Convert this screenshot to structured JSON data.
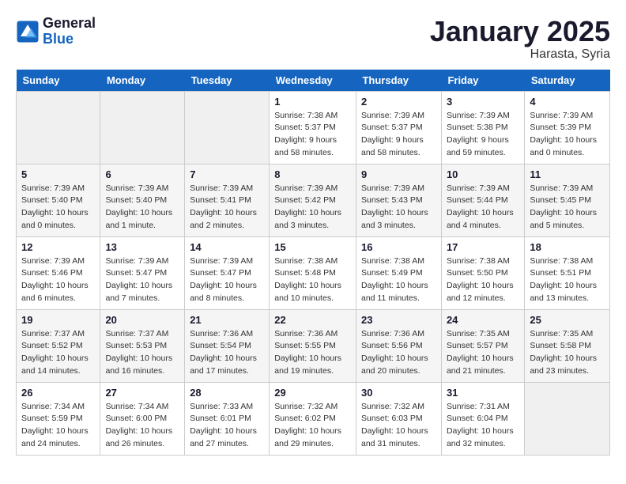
{
  "logo": {
    "text_general": "General",
    "text_blue": "Blue"
  },
  "title": "January 2025",
  "subtitle": "Harasta, Syria",
  "days_of_week": [
    "Sunday",
    "Monday",
    "Tuesday",
    "Wednesday",
    "Thursday",
    "Friday",
    "Saturday"
  ],
  "weeks": [
    [
      {
        "day": "",
        "info": ""
      },
      {
        "day": "",
        "info": ""
      },
      {
        "day": "",
        "info": ""
      },
      {
        "day": "1",
        "info": "Sunrise: 7:38 AM\nSunset: 5:37 PM\nDaylight: 9 hours and 58 minutes."
      },
      {
        "day": "2",
        "info": "Sunrise: 7:39 AM\nSunset: 5:37 PM\nDaylight: 9 hours and 58 minutes."
      },
      {
        "day": "3",
        "info": "Sunrise: 7:39 AM\nSunset: 5:38 PM\nDaylight: 9 hours and 59 minutes."
      },
      {
        "day": "4",
        "info": "Sunrise: 7:39 AM\nSunset: 5:39 PM\nDaylight: 10 hours and 0 minutes."
      }
    ],
    [
      {
        "day": "5",
        "info": "Sunrise: 7:39 AM\nSunset: 5:40 PM\nDaylight: 10 hours and 0 minutes."
      },
      {
        "day": "6",
        "info": "Sunrise: 7:39 AM\nSunset: 5:40 PM\nDaylight: 10 hours and 1 minute."
      },
      {
        "day": "7",
        "info": "Sunrise: 7:39 AM\nSunset: 5:41 PM\nDaylight: 10 hours and 2 minutes."
      },
      {
        "day": "8",
        "info": "Sunrise: 7:39 AM\nSunset: 5:42 PM\nDaylight: 10 hours and 3 minutes."
      },
      {
        "day": "9",
        "info": "Sunrise: 7:39 AM\nSunset: 5:43 PM\nDaylight: 10 hours and 3 minutes."
      },
      {
        "day": "10",
        "info": "Sunrise: 7:39 AM\nSunset: 5:44 PM\nDaylight: 10 hours and 4 minutes."
      },
      {
        "day": "11",
        "info": "Sunrise: 7:39 AM\nSunset: 5:45 PM\nDaylight: 10 hours and 5 minutes."
      }
    ],
    [
      {
        "day": "12",
        "info": "Sunrise: 7:39 AM\nSunset: 5:46 PM\nDaylight: 10 hours and 6 minutes."
      },
      {
        "day": "13",
        "info": "Sunrise: 7:39 AM\nSunset: 5:47 PM\nDaylight: 10 hours and 7 minutes."
      },
      {
        "day": "14",
        "info": "Sunrise: 7:39 AM\nSunset: 5:47 PM\nDaylight: 10 hours and 8 minutes."
      },
      {
        "day": "15",
        "info": "Sunrise: 7:38 AM\nSunset: 5:48 PM\nDaylight: 10 hours and 10 minutes."
      },
      {
        "day": "16",
        "info": "Sunrise: 7:38 AM\nSunset: 5:49 PM\nDaylight: 10 hours and 11 minutes."
      },
      {
        "day": "17",
        "info": "Sunrise: 7:38 AM\nSunset: 5:50 PM\nDaylight: 10 hours and 12 minutes."
      },
      {
        "day": "18",
        "info": "Sunrise: 7:38 AM\nSunset: 5:51 PM\nDaylight: 10 hours and 13 minutes."
      }
    ],
    [
      {
        "day": "19",
        "info": "Sunrise: 7:37 AM\nSunset: 5:52 PM\nDaylight: 10 hours and 14 minutes."
      },
      {
        "day": "20",
        "info": "Sunrise: 7:37 AM\nSunset: 5:53 PM\nDaylight: 10 hours and 16 minutes."
      },
      {
        "day": "21",
        "info": "Sunrise: 7:36 AM\nSunset: 5:54 PM\nDaylight: 10 hours and 17 minutes."
      },
      {
        "day": "22",
        "info": "Sunrise: 7:36 AM\nSunset: 5:55 PM\nDaylight: 10 hours and 19 minutes."
      },
      {
        "day": "23",
        "info": "Sunrise: 7:36 AM\nSunset: 5:56 PM\nDaylight: 10 hours and 20 minutes."
      },
      {
        "day": "24",
        "info": "Sunrise: 7:35 AM\nSunset: 5:57 PM\nDaylight: 10 hours and 21 minutes."
      },
      {
        "day": "25",
        "info": "Sunrise: 7:35 AM\nSunset: 5:58 PM\nDaylight: 10 hours and 23 minutes."
      }
    ],
    [
      {
        "day": "26",
        "info": "Sunrise: 7:34 AM\nSunset: 5:59 PM\nDaylight: 10 hours and 24 minutes."
      },
      {
        "day": "27",
        "info": "Sunrise: 7:34 AM\nSunset: 6:00 PM\nDaylight: 10 hours and 26 minutes."
      },
      {
        "day": "28",
        "info": "Sunrise: 7:33 AM\nSunset: 6:01 PM\nDaylight: 10 hours and 27 minutes."
      },
      {
        "day": "29",
        "info": "Sunrise: 7:32 AM\nSunset: 6:02 PM\nDaylight: 10 hours and 29 minutes."
      },
      {
        "day": "30",
        "info": "Sunrise: 7:32 AM\nSunset: 6:03 PM\nDaylight: 10 hours and 31 minutes."
      },
      {
        "day": "31",
        "info": "Sunrise: 7:31 AM\nSunset: 6:04 PM\nDaylight: 10 hours and 32 minutes."
      },
      {
        "day": "",
        "info": ""
      }
    ]
  ]
}
